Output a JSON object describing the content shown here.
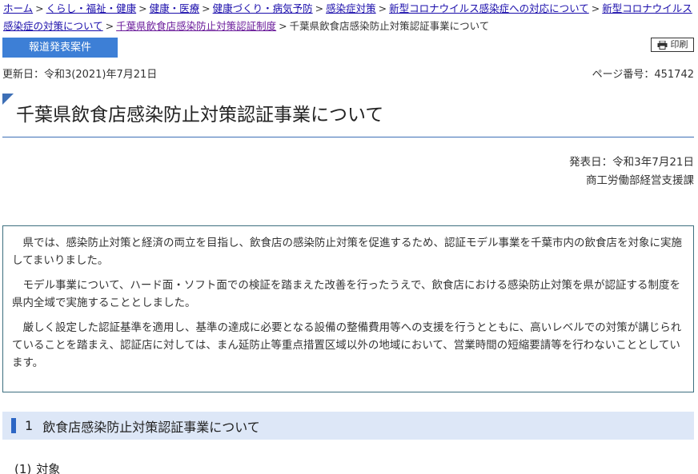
{
  "breadcrumb": {
    "items": [
      {
        "label": "ホーム"
      },
      {
        "label": "くらし・福祉・健康"
      },
      {
        "label": "健康・医療"
      },
      {
        "label": "健康づくり・病気予防"
      },
      {
        "label": "感染症対策"
      },
      {
        "label": "新型コロナウイルス感染症への対応について"
      },
      {
        "label": "新型コロナウイルス感染症の対策について"
      },
      {
        "label": "千葉県飲食店感染防止対策認証制度"
      }
    ],
    "current": "千葉県飲食店感染防止対策認証事業について",
    "separator": ">"
  },
  "press_label": "報道発表案件",
  "print_label": "印刷",
  "updated": "更新日：令和3(2021)年7月21日",
  "page_number": "ページ番号：451742",
  "title": "千葉県飲食店感染防止対策認証事業について",
  "published": "発表日：令和3年7月21日",
  "department": "商工労働部経営支援課",
  "intro": {
    "paragraphs": [
      "県では、感染防止対策と経済の両立を目指し、飲食店の感染防止対策を促進するため、認証モデル事業を千葉市内の飲食店を対象に実施してまいりました。",
      "モデル事業について、ハード面・ソフト面での検証を踏まえた改善を行ったうえで、飲食店における感染防止対策を県が認証する制度を県内全域で実施することとしました。",
      "厳しく設定した認証基準を適用し、基準の達成に必要となる設備の整備費用等への支援を行うとともに、高いレベルでの対策が講じられていることを踏まえ、認証店に対しては、まん延防止等重点措置区域以外の地域において、営業時間の短縮要請等を行わないこととしています。"
    ]
  },
  "section1": {
    "number": "1",
    "title": "飲食店感染防止対策認証事業について"
  },
  "subsection1": {
    "label": "(1)",
    "title": "対象"
  },
  "colors": {
    "accent": "#3d7fd6",
    "link": "#1a0dab",
    "section_bg": "#dde7f7"
  },
  "icons": {
    "print": "printer-icon"
  }
}
